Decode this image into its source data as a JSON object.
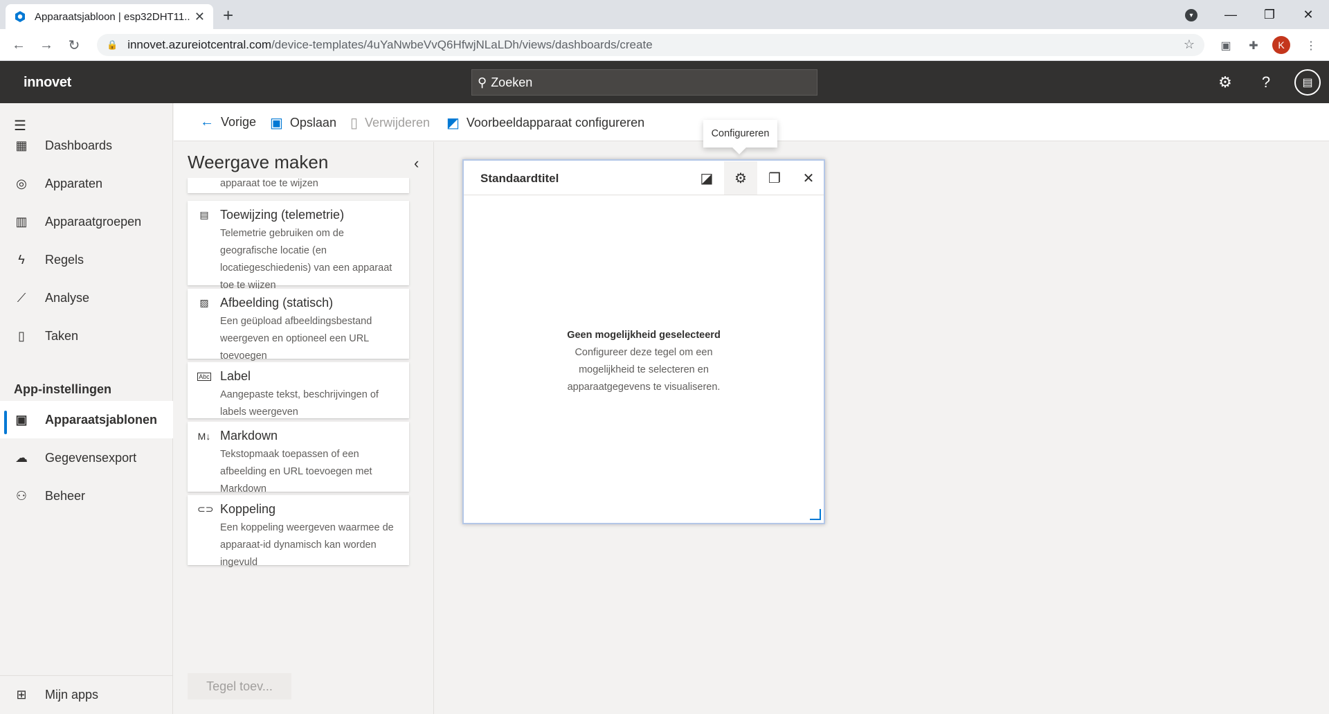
{
  "browser": {
    "tab_title": "Apparaatsjabloon | esp32DHT11...",
    "url_host": "innovet.azureiotcentral.com",
    "url_path": "/device-templates/4uYaNwbeVvQ6HfwjNLaLDh/views/dashboards/create",
    "profile_initial": "K"
  },
  "header": {
    "brand": "innovet",
    "search_placeholder": "Zoeken"
  },
  "nav": {
    "items": [
      {
        "label": "Dashboards",
        "icon": "dashboard-icon"
      },
      {
        "label": "Apparaten",
        "icon": "devices-icon"
      },
      {
        "label": "Apparaatgroepen",
        "icon": "device-groups-icon"
      },
      {
        "label": "Regels",
        "icon": "rules-icon"
      },
      {
        "label": "Analyse",
        "icon": "analytics-icon"
      },
      {
        "label": "Taken",
        "icon": "jobs-icon"
      }
    ],
    "section": "App-instellingen",
    "settings_items": [
      {
        "label": "Apparaatsjablonen",
        "icon": "device-templates-icon",
        "active": true
      },
      {
        "label": "Gegevensexport",
        "icon": "data-export-icon"
      },
      {
        "label": "Beheer",
        "icon": "administration-icon"
      }
    ],
    "bottom": {
      "label": "Mijn apps",
      "icon": "my-apps-icon"
    }
  },
  "toolbar": {
    "back": "Vorige",
    "save": "Opslaan",
    "delete": "Verwijderen",
    "configure_sample": "Voorbeeldapparaat configureren"
  },
  "panel": {
    "title": "Weergave maken",
    "cut_text": "apparaat toe te wijzen",
    "cards": [
      {
        "title": "Toewijzing (telemetrie)",
        "desc": "Telemetrie gebruiken om de geografische locatie (en locatiegeschiedenis) van een apparaat toe te wijzen",
        "icon": "map-icon"
      },
      {
        "title": "Afbeelding (statisch)",
        "desc": "Een geüpload afbeeldingsbestand weergeven en optioneel een URL toevoegen",
        "icon": "image-icon"
      },
      {
        "title": "Label",
        "desc": "Aangepaste tekst, beschrijvingen of labels weergeven",
        "icon": "label-icon"
      },
      {
        "title": "Markdown",
        "desc": "Tekstopmaak toepassen of een afbeelding en URL toevoegen met Markdown",
        "icon": "markdown-icon"
      },
      {
        "title": "Koppeling",
        "desc": "Een koppeling weergeven waarmee de apparaat-id dynamisch kan worden ingevuld",
        "icon": "link-icon"
      }
    ],
    "add_tile": "Tegel toev..."
  },
  "tile": {
    "title": "Standaardtitel",
    "empty_title": "Geen mogelijkheid geselecteerd",
    "empty_line1": "Configureer deze tegel om een",
    "empty_line2": "mogelijkheid te selecteren en",
    "empty_line3": "apparaatgegevens te visualiseren.",
    "tooltip": "Configureren"
  }
}
